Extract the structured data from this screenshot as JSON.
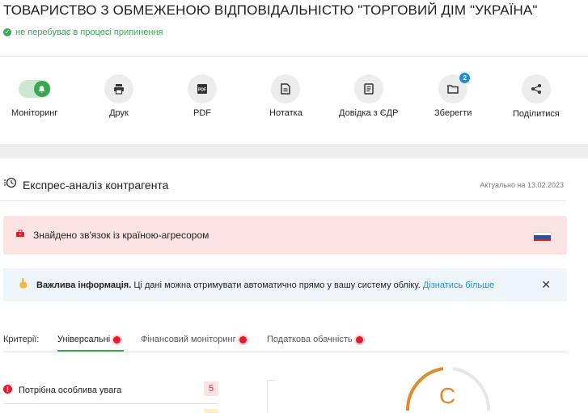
{
  "company": {
    "title": "ТОВАРИСТВО З ОБМЕЖЕНОЮ ВІДПОВІДАЛЬНІСТЮ \"ТОРГОВИЙ ДІМ \"УКРАЇНА\"",
    "status": "не перебуває в процесі припинення"
  },
  "toolbar": {
    "monitoring": "Моніторинг",
    "print": "Друк",
    "pdf": "PDF",
    "note": "Нотатка",
    "edr": "Довідка з ЄДР",
    "save": "Зберегти",
    "save_badge": "2",
    "share": "Поділитися"
  },
  "express": {
    "title": "Експрес-аналіз контрагента",
    "date": "Актуально на 13.02.2023"
  },
  "alerts": {
    "aggressor": "Знайдено зв'язок із країною-агресором",
    "info_bold": "Важлива інформація.",
    "info_text": " Ці дані можна отримувати автоматично прямо у вашу систему обліку. ",
    "info_link": "Дізнатись більше"
  },
  "criteria": {
    "label": "Критерії:",
    "tabs": [
      "Універсальні",
      "Фінансовий моніторинг",
      "Податкова обачність"
    ]
  },
  "risks": {
    "attention_label": "Потрібна особлива увага",
    "attention_count": "5"
  },
  "rating": {
    "grade": "C"
  },
  "colors": {
    "accent_green": "#3aa757",
    "danger_red": "#e8192c",
    "link_blue": "#1f8fd6",
    "gauge_orange": "#e08a2e"
  },
  "icons": {
    "monitoring": "bell-icon",
    "print": "printer-icon",
    "pdf": "pdf-icon",
    "note": "note-icon",
    "edr": "document-icon",
    "save": "folder-icon",
    "share": "share-icon"
  }
}
